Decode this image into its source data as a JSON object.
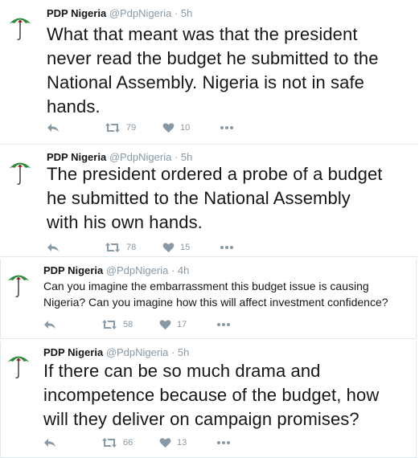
{
  "tweets": [
    {
      "name": "PDP Nigeria",
      "handle": "@PdpNigeria",
      "separator": "·",
      "time": "5h",
      "text_lines": [
        "What that meant was that the president",
        "never read the budget he submitted to the",
        "National Assembly. Nigeria is not in safe",
        "hands."
      ],
      "retweets": "79",
      "likes": "10"
    },
    {
      "name": "PDP Nigeria",
      "handle": "@PdpNigeria",
      "separator": "·",
      "time": "5h",
      "text_lines": [
        "The president ordered a probe of a budget",
        "he submitted to the National Assembly",
        "with his own hands."
      ],
      "retweets": "78",
      "likes": "15"
    },
    {
      "name": "PDP Nigeria",
      "handle": "@PdpNigeria",
      "separator": "·",
      "time": "4h",
      "text_lines": [
        "Can you imagine the embarrassment this budget issue is causing",
        "Nigeria? Can you imagine how this will affect investment confidence?"
      ],
      "retweets": "58",
      "likes": "17"
    },
    {
      "name": "PDP Nigeria",
      "handle": "@PdpNigeria",
      "separator": "·",
      "time": "5h",
      "text_lines": [
        "If there can be so much drama and",
        "incompetence because of the budget, how",
        "will they deliver on campaign promises?"
      ],
      "retweets": "66",
      "likes": "13"
    }
  ],
  "icons": {
    "avatar": "pdp-umbrella-logo",
    "reply": "reply-icon",
    "retweet": "retweet-icon",
    "like": "heart-icon",
    "more": "more-icon"
  },
  "colors": {
    "muted": "#8899a6",
    "text": "#14171a",
    "divider": "#e1e8ed",
    "logo_green": "#2e8b3a",
    "logo_red": "#d8232a"
  }
}
